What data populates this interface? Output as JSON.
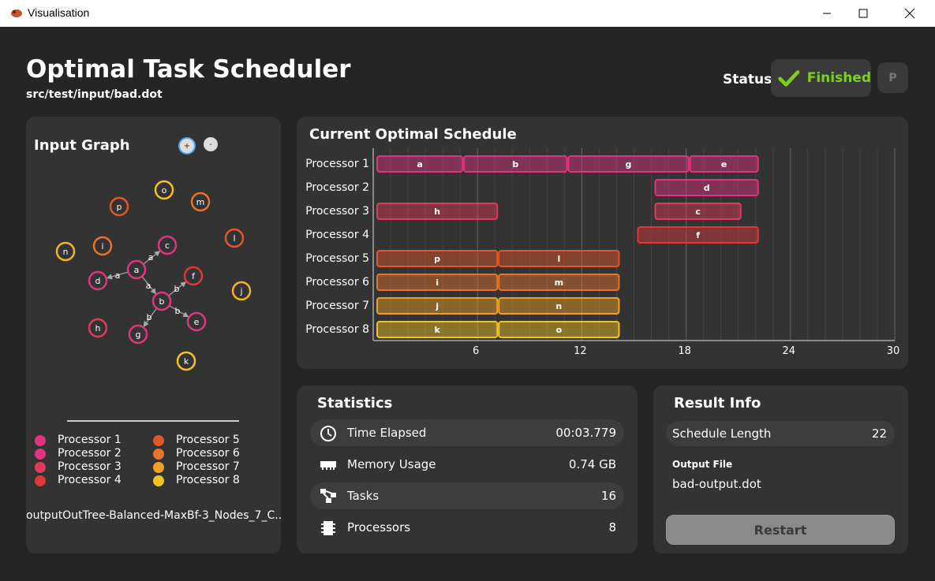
{
  "window": {
    "title": "Visualisation"
  },
  "header": {
    "title": "Optimal Task Scheduler",
    "input_path": "src/test/input/bad.dot",
    "status_label": "Status",
    "status_value": "Finished",
    "status_color": "#7bd11c",
    "pause_label": "P"
  },
  "graph_panel": {
    "title": "Input Graph",
    "zoom_in": "+",
    "zoom_out": "-",
    "caption": "outputOutTree-Balanced-MaxBf-3_Nodes_7_C...",
    "nodes": [
      {
        "id": "a",
        "color": "#e0347e"
      },
      {
        "id": "b",
        "color": "#e0347e"
      },
      {
        "id": "c",
        "color": "#e0347e"
      },
      {
        "id": "d",
        "color": "#e0347e"
      },
      {
        "id": "e",
        "color": "#e0347e"
      },
      {
        "id": "f",
        "color": "#e0363a"
      },
      {
        "id": "g",
        "color": "#e0347e"
      },
      {
        "id": "h",
        "color": "#e03a5a"
      },
      {
        "id": "i",
        "color": "#e8732a"
      },
      {
        "id": "j",
        "color": "#f2b522"
      },
      {
        "id": "k",
        "color": "#f2c322"
      },
      {
        "id": "l",
        "color": "#e2562a"
      },
      {
        "id": "m",
        "color": "#e8732a"
      },
      {
        "id": "n",
        "color": "#f2b522"
      },
      {
        "id": "o",
        "color": "#f2c322"
      },
      {
        "id": "p",
        "color": "#e2562a"
      }
    ],
    "edge_labels": [
      "a",
      "a",
      "a",
      "b",
      "b",
      "b"
    ],
    "legend": [
      {
        "label": "Processor 1",
        "color": "#e0347e"
      },
      {
        "label": "Processor 2",
        "color": "#e0347e"
      },
      {
        "label": "Processor 3",
        "color": "#e03a5a"
      },
      {
        "label": "Processor 4",
        "color": "#e0363a"
      },
      {
        "label": "Processor 5",
        "color": "#e2562a"
      },
      {
        "label": "Processor 6",
        "color": "#e8732a"
      },
      {
        "label": "Processor 7",
        "color": "#f2a022"
      },
      {
        "label": "Processor 8",
        "color": "#f2c322"
      }
    ]
  },
  "schedule_panel": {
    "title": "Current Optimal Schedule"
  },
  "chart_data": {
    "type": "gantt",
    "title": "Current Optimal Schedule",
    "xlim": [
      0,
      30
    ],
    "xticks": [
      6,
      12,
      18,
      24,
      30
    ],
    "rows": [
      "Processor 1",
      "Processor 2",
      "Processor 3",
      "Processor 4",
      "Processor 5",
      "Processor 6",
      "Processor 7",
      "Processor 8"
    ],
    "tasks": [
      {
        "row": 0,
        "name": "a",
        "start": 0,
        "end": 5,
        "color": "#e0347e"
      },
      {
        "row": 0,
        "name": "b",
        "start": 5,
        "end": 11,
        "color": "#e0347e"
      },
      {
        "row": 0,
        "name": "g",
        "start": 11,
        "end": 18,
        "color": "#e0347e"
      },
      {
        "row": 0,
        "name": "e",
        "start": 18,
        "end": 22,
        "color": "#e0347e"
      },
      {
        "row": 1,
        "name": "d",
        "start": 16,
        "end": 22,
        "color": "#e0347e"
      },
      {
        "row": 2,
        "name": "h",
        "start": 0,
        "end": 7,
        "color": "#e03a5a"
      },
      {
        "row": 2,
        "name": "c",
        "start": 16,
        "end": 21,
        "color": "#e03a5a"
      },
      {
        "row": 3,
        "name": "f",
        "start": 15,
        "end": 22,
        "color": "#e0363a"
      },
      {
        "row": 4,
        "name": "p",
        "start": 0,
        "end": 7,
        "color": "#e2562a"
      },
      {
        "row": 4,
        "name": "l",
        "start": 7,
        "end": 14,
        "color": "#e2562a"
      },
      {
        "row": 5,
        "name": "i",
        "start": 0,
        "end": 7,
        "color": "#e8732a"
      },
      {
        "row": 5,
        "name": "m",
        "start": 7,
        "end": 14,
        "color": "#e8732a"
      },
      {
        "row": 6,
        "name": "j",
        "start": 0,
        "end": 7,
        "color": "#f2a022"
      },
      {
        "row": 6,
        "name": "n",
        "start": 7,
        "end": 14,
        "color": "#f2a022"
      },
      {
        "row": 7,
        "name": "k",
        "start": 0,
        "end": 7,
        "color": "#f2c322"
      },
      {
        "row": 7,
        "name": "o",
        "start": 7,
        "end": 14,
        "color": "#f2c322"
      }
    ]
  },
  "statistics": {
    "title": "Statistics",
    "rows": [
      {
        "icon": "clock-icon",
        "label": "Time Elapsed",
        "value": "00:03.779"
      },
      {
        "icon": "memory-icon",
        "label": "Memory Usage",
        "value": "0.74 GB"
      },
      {
        "icon": "tasks-icon",
        "label": "Tasks",
        "value": "16"
      },
      {
        "icon": "processor-icon",
        "label": "Processors",
        "value": "8"
      }
    ]
  },
  "result": {
    "title": "Result Info",
    "schedule_length_label": "Schedule Length",
    "schedule_length_value": "22",
    "output_file_label": "Output File",
    "output_file_value": "bad-output.dot",
    "restart_label": "Restart"
  }
}
